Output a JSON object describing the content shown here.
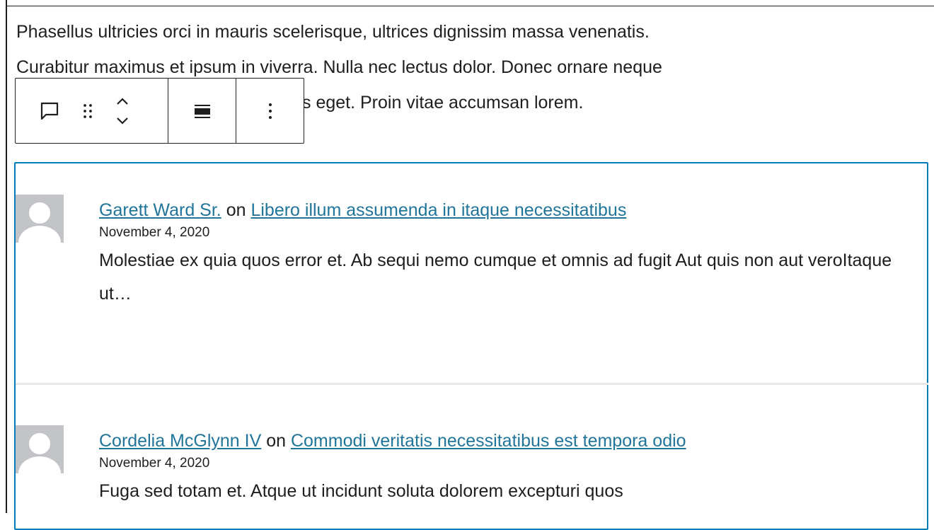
{
  "paragraph": {
    "lines": [
      "Phasellus ultricies orci in mauris scelerisque, ultrices dignissim massa venenatis.",
      "Curabitur maximus et ipsum in viverra. Nulla nec lectus dolor. Donec ornare neque",
      "s eget. Proin vitae accumsan lorem."
    ]
  },
  "toolbar": {
    "icons": [
      "comment-icon",
      "drag-handle-icon",
      "move-up-icon",
      "move-down-icon",
      "align-icon",
      "more-options-icon"
    ]
  },
  "comments": [
    {
      "author": "Garett Ward Sr.",
      "on": "on",
      "post": "Libero illum assumenda in itaque necessitatibus",
      "date": "November 4, 2020",
      "excerpt": "Molestiae ex quia quos error et. Ab sequi nemo cumque et omnis ad fugit Aut quis non aut veroItaque ut…"
    },
    {
      "author": "Cordelia McGlynn IV",
      "on": "on",
      "post": "Commodi veritatis necessitatibus est tempora odio",
      "date": "November 4, 2020",
      "excerpt": "Fuga sed totam et. Atque ut incidunt soluta dolorem excepturi quos"
    }
  ],
  "colors": {
    "accent": "#007cba",
    "link": "#21759b",
    "text": "#1e1e1e",
    "avatar_bg": "#c3c4c7"
  }
}
